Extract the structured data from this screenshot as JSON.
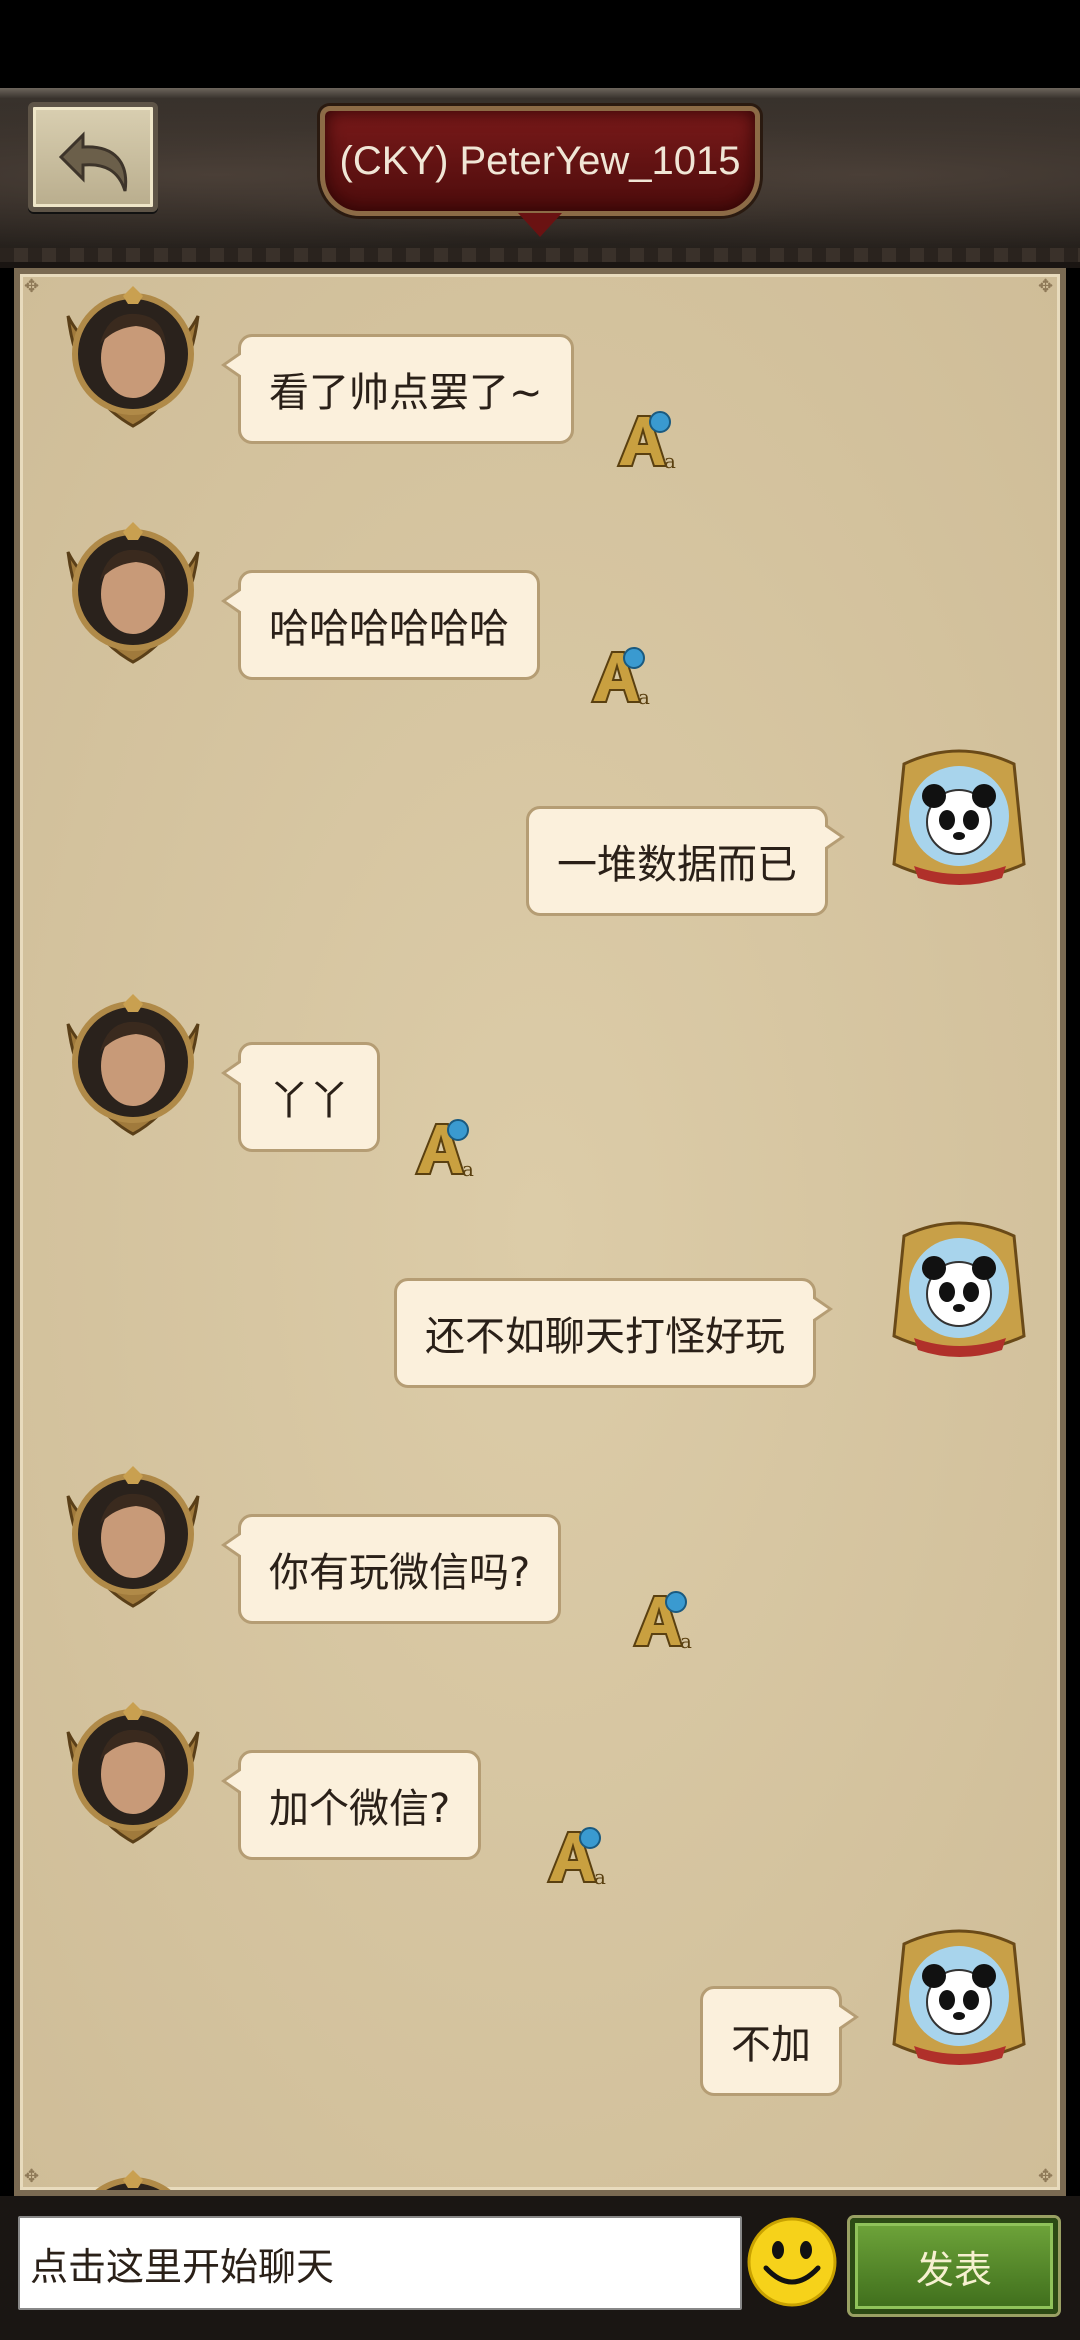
{
  "header": {
    "title": "(CKY) PeterYew_1015",
    "back_icon": "back-arrow-icon"
  },
  "messages": [
    {
      "side": "left",
      "text": "看了帅点罢了~"
    },
    {
      "side": "left",
      "text": "哈哈哈哈哈哈"
    },
    {
      "side": "right",
      "text": "一堆数据而已"
    },
    {
      "side": "left",
      "text": "丫丫"
    },
    {
      "side": "right",
      "text": "还不如聊天打怪好玩"
    },
    {
      "side": "left",
      "text": "你有玩微信吗?"
    },
    {
      "side": "left",
      "text": "加个微信?"
    },
    {
      "side": "right",
      "text": "不加"
    }
  ],
  "input": {
    "placeholder": "点击这里开始聊天"
  },
  "send_label": "发表",
  "colors": {
    "panel": "#d8c7a3",
    "bubble": "#fbf0dc",
    "title_plate": "#7a1a1a",
    "send_button": "#4f8a26"
  }
}
